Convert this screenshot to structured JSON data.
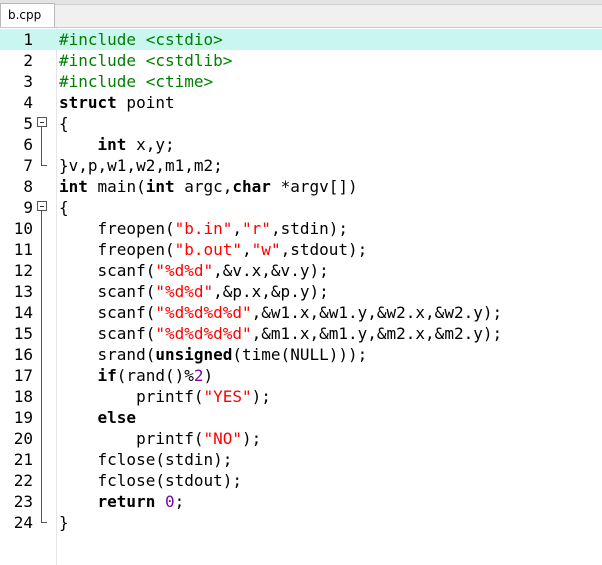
{
  "tab": {
    "label": "b.cpp"
  },
  "current_line": 1,
  "lines": [
    {
      "num": "1",
      "fold": "",
      "tokens": [
        {
          "t": "pre",
          "v": "#include <cstdio>"
        }
      ]
    },
    {
      "num": "2",
      "fold": "",
      "tokens": [
        {
          "t": "pre",
          "v": "#include <cstdlib>"
        }
      ]
    },
    {
      "num": "3",
      "fold": "",
      "tokens": [
        {
          "t": "pre",
          "v": "#include <ctime>"
        }
      ]
    },
    {
      "num": "4",
      "fold": "",
      "tokens": [
        {
          "t": "kw",
          "v": "struct"
        },
        {
          "t": "plain",
          "v": " point"
        }
      ]
    },
    {
      "num": "5",
      "fold": "open",
      "tokens": [
        {
          "t": "plain",
          "v": "{"
        }
      ]
    },
    {
      "num": "6",
      "fold": "mid",
      "tokens": [
        {
          "t": "plain",
          "v": "    "
        },
        {
          "t": "kw",
          "v": "int"
        },
        {
          "t": "plain",
          "v": " x,y;"
        }
      ]
    },
    {
      "num": "7",
      "fold": "end",
      "tokens": [
        {
          "t": "plain",
          "v": "}v,p,w1,w2,m1,m2;"
        }
      ]
    },
    {
      "num": "8",
      "fold": "",
      "tokens": [
        {
          "t": "kw",
          "v": "int"
        },
        {
          "t": "plain",
          "v": " main("
        },
        {
          "t": "kw",
          "v": "int"
        },
        {
          "t": "plain",
          "v": " argc,"
        },
        {
          "t": "kw",
          "v": "char"
        },
        {
          "t": "plain",
          "v": " *argv[])"
        }
      ]
    },
    {
      "num": "9",
      "fold": "open",
      "tokens": [
        {
          "t": "plain",
          "v": "{"
        }
      ]
    },
    {
      "num": "10",
      "fold": "mid",
      "tokens": [
        {
          "t": "plain",
          "v": "    freopen("
        },
        {
          "t": "str",
          "v": "\"b.in\""
        },
        {
          "t": "plain",
          "v": ","
        },
        {
          "t": "str",
          "v": "\"r\""
        },
        {
          "t": "plain",
          "v": ",stdin);"
        }
      ]
    },
    {
      "num": "11",
      "fold": "mid",
      "tokens": [
        {
          "t": "plain",
          "v": "    freopen("
        },
        {
          "t": "str",
          "v": "\"b.out\""
        },
        {
          "t": "plain",
          "v": ","
        },
        {
          "t": "str",
          "v": "\"w\""
        },
        {
          "t": "plain",
          "v": ",stdout);"
        }
      ]
    },
    {
      "num": "12",
      "fold": "mid",
      "tokens": [
        {
          "t": "plain",
          "v": "    scanf("
        },
        {
          "t": "str",
          "v": "\"%d%d\""
        },
        {
          "t": "plain",
          "v": ",&v.x,&v.y);"
        }
      ]
    },
    {
      "num": "13",
      "fold": "mid",
      "tokens": [
        {
          "t": "plain",
          "v": "    scanf("
        },
        {
          "t": "str",
          "v": "\"%d%d\""
        },
        {
          "t": "plain",
          "v": ",&p.x,&p.y);"
        }
      ]
    },
    {
      "num": "14",
      "fold": "mid",
      "tokens": [
        {
          "t": "plain",
          "v": "    scanf("
        },
        {
          "t": "str",
          "v": "\"%d%d%d%d\""
        },
        {
          "t": "plain",
          "v": ",&w1.x,&w1.y,&w2.x,&w2.y);"
        }
      ]
    },
    {
      "num": "15",
      "fold": "mid",
      "tokens": [
        {
          "t": "plain",
          "v": "    scanf("
        },
        {
          "t": "str",
          "v": "\"%d%d%d%d\""
        },
        {
          "t": "plain",
          "v": ",&m1.x,&m1.y,&m2.x,&m2.y);"
        }
      ]
    },
    {
      "num": "16",
      "fold": "mid",
      "tokens": [
        {
          "t": "plain",
          "v": "    srand("
        },
        {
          "t": "kw",
          "v": "unsigned"
        },
        {
          "t": "plain",
          "v": "(time(NULL)));"
        }
      ]
    },
    {
      "num": "17",
      "fold": "mid",
      "tokens": [
        {
          "t": "plain",
          "v": "    "
        },
        {
          "t": "kw",
          "v": "if"
        },
        {
          "t": "plain",
          "v": "(rand()%"
        },
        {
          "t": "num",
          "v": "2"
        },
        {
          "t": "plain",
          "v": ")"
        }
      ]
    },
    {
      "num": "18",
      "fold": "mid",
      "tokens": [
        {
          "t": "plain",
          "v": "        printf("
        },
        {
          "t": "str",
          "v": "\"YES\""
        },
        {
          "t": "plain",
          "v": ");"
        }
      ]
    },
    {
      "num": "19",
      "fold": "mid",
      "tokens": [
        {
          "t": "plain",
          "v": "    "
        },
        {
          "t": "kw",
          "v": "else"
        }
      ]
    },
    {
      "num": "20",
      "fold": "mid",
      "tokens": [
        {
          "t": "plain",
          "v": "        printf("
        },
        {
          "t": "str",
          "v": "\"NO\""
        },
        {
          "t": "plain",
          "v": ");"
        }
      ]
    },
    {
      "num": "21",
      "fold": "mid",
      "tokens": [
        {
          "t": "plain",
          "v": "    fclose(stdin);"
        }
      ]
    },
    {
      "num": "22",
      "fold": "mid",
      "tokens": [
        {
          "t": "plain",
          "v": "    fclose(stdout);"
        }
      ]
    },
    {
      "num": "23",
      "fold": "mid",
      "tokens": [
        {
          "t": "plain",
          "v": "    "
        },
        {
          "t": "kw",
          "v": "return"
        },
        {
          "t": "plain",
          "v": " "
        },
        {
          "t": "num",
          "v": "0"
        },
        {
          "t": "plain",
          "v": ";"
        }
      ]
    },
    {
      "num": "24",
      "fold": "end",
      "tokens": [
        {
          "t": "plain",
          "v": "}"
        }
      ]
    }
  ]
}
